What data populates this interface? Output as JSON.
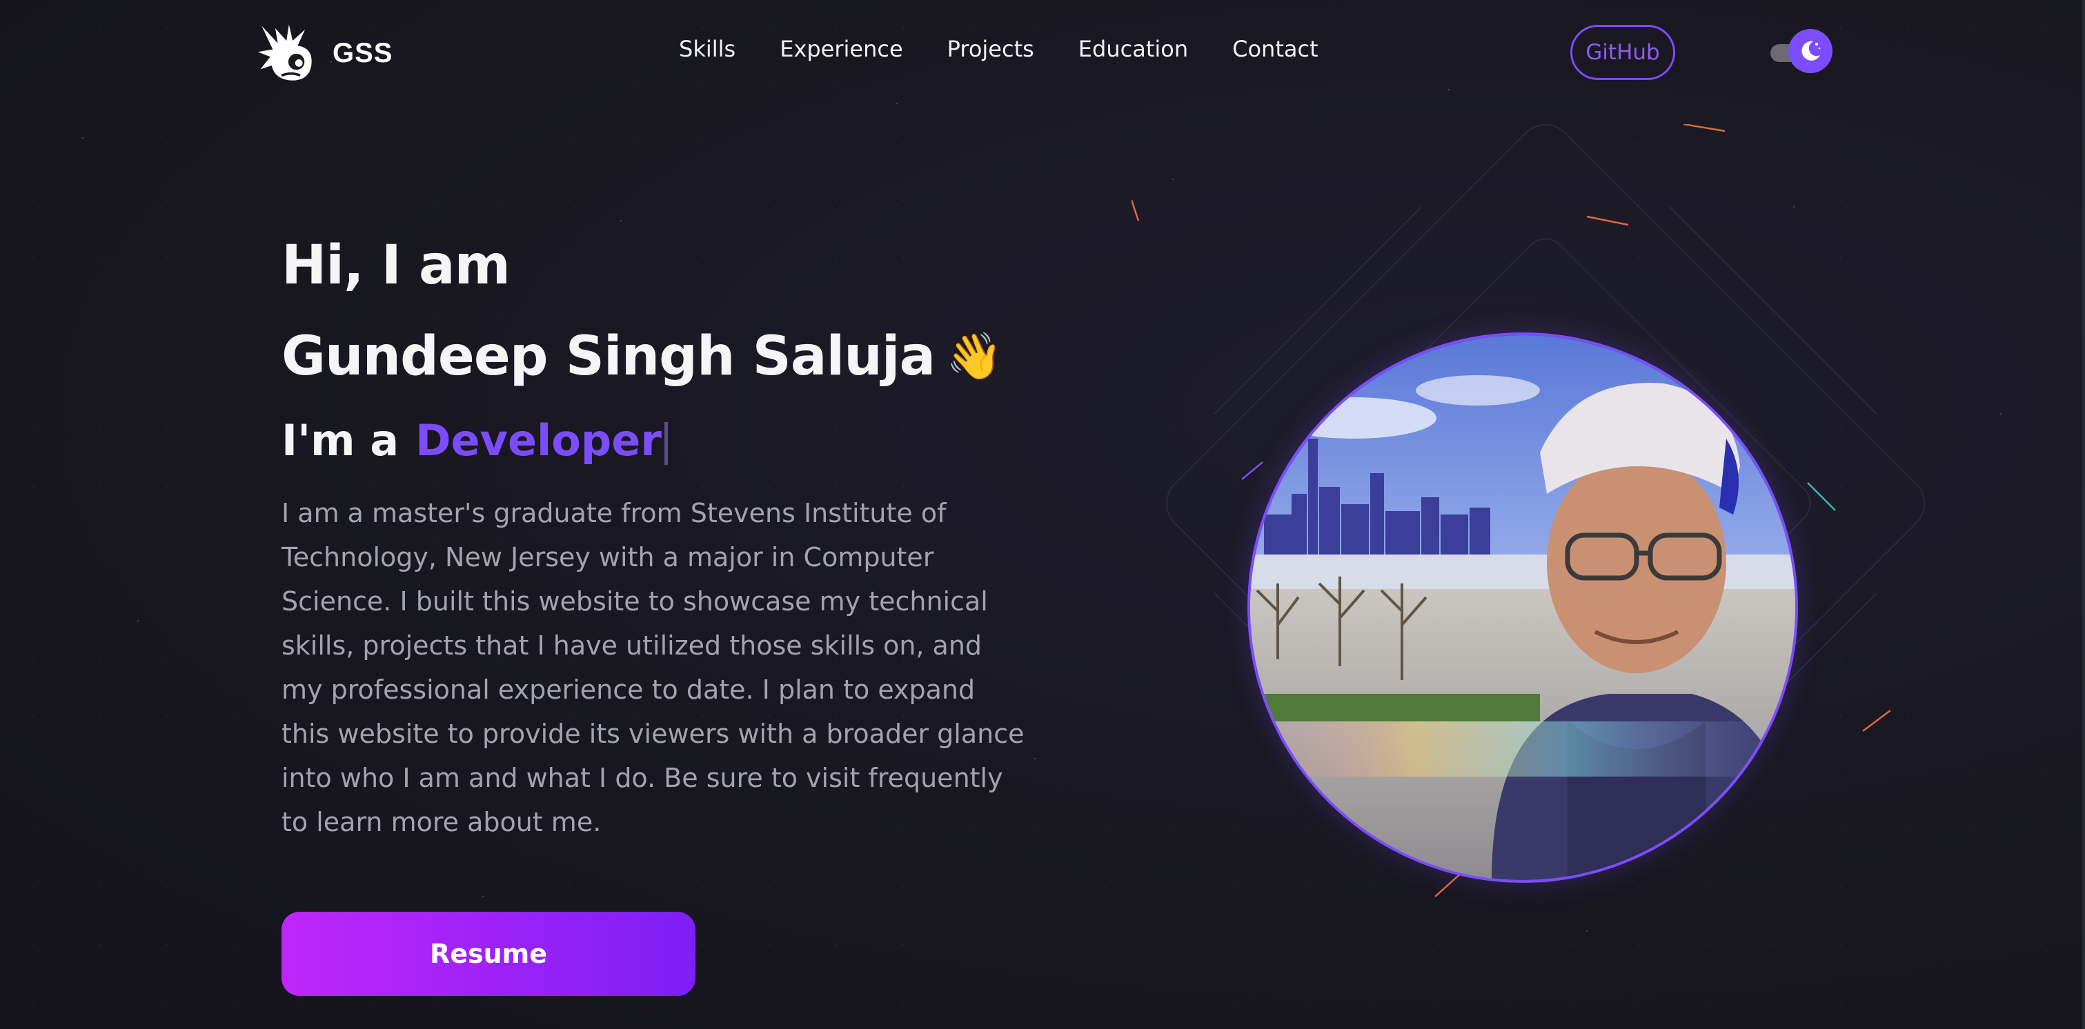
{
  "nav": {
    "logo_text": "GSS",
    "links": [
      "Skills",
      "Experience",
      "Projects",
      "Education",
      "Contact"
    ],
    "github_label": "GitHub"
  },
  "hero": {
    "greeting": "Hi, I am",
    "name": "Gundeep Singh Saluja",
    "wave_emoji": "👋",
    "role_prefix": "I'm a",
    "role_word": "Developer",
    "bio": "I am a master's graduate from Stevens Institute of Technology, New Jersey with a major in Computer Science. I built this website to showcase my technical skills, projects that I have utilized those skills on, and my professional experience to date. I plan to expand this website to provide its viewers with a broader glance into who I am and what I do. Be sure to visit frequently to learn more about me.",
    "resume_label": "Resume"
  },
  "icons": {
    "logo": "stylized-spiky-creature-logo",
    "theme": "moon-icon"
  },
  "colors": {
    "background": "#18171f",
    "accent": "#7c4dff",
    "resume_gradient_start": "#c026fa",
    "resume_gradient_end": "#7c1ff5",
    "bio_text": "#a3a3ad"
  }
}
